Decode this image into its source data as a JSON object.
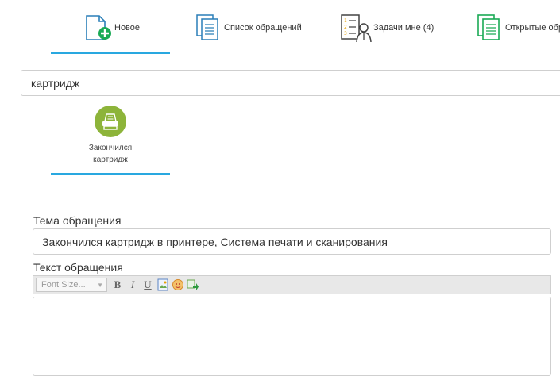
{
  "tabs": [
    {
      "label": "Новое",
      "icon": "new-document-icon"
    },
    {
      "label": "Список обращений",
      "icon": "document-list-icon"
    },
    {
      "label": "Задачи мне (4)",
      "icon": "tasks-person-icon"
    },
    {
      "label": "Открытые обр",
      "icon": "open-documents-icon"
    }
  ],
  "search": {
    "value": "картридж"
  },
  "category": {
    "label_line1": "Закончился",
    "label_line2": "картридж",
    "icon": "printer-icon",
    "color": "#8db43a"
  },
  "subject": {
    "label": "Тема обращения",
    "value": "Закончился картридж в принтере, Система печати и сканирования"
  },
  "body": {
    "label": "Текст обращения",
    "font_size_placeholder": "Font Size..."
  },
  "colors": {
    "accent": "#29a8e0",
    "green": "#1aaa55"
  }
}
